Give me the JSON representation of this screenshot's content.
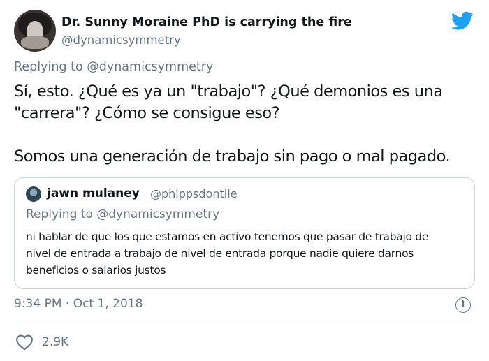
{
  "author": {
    "name": "Dr. Sunny Moraine PhD is carrying the fire",
    "handle": "@dynamicsymmetry"
  },
  "replying": {
    "prefix": "Replying to",
    "handle": "@dynamicsymmetry"
  },
  "tweet": {
    "lines": [
      "Sí, esto. ¿Qué es ya un \"trabajo\"? ¿Qué demonios es una",
      "\"carrera\"? ¿Cómo se consigue eso?",
      "Somos una generación de trabajo sin pago o mal pagado."
    ]
  },
  "quoted": {
    "name": "jawn mulaney",
    "handle": "@phippsdontlie",
    "replying_prefix": "Replying to",
    "replying_handle": "@dynamicsymmetry",
    "lines": [
      "ni hablar de que los que estamos en activo tenemos que pasar de trabajo de",
      "nivel de entrada a trabajo de nivel de entrada porque nadie quiere darnos",
      "beneficios o salarios justos"
    ]
  },
  "meta": {
    "timestamp": "9:34 PM · Oct 1, 2018",
    "info_glyph": "i"
  },
  "actions": {
    "likes": "2.9K"
  },
  "icons": {
    "brand": "twitter-bird-icon",
    "like": "heart-icon",
    "info": "info-icon"
  },
  "colors": {
    "brand": "#1da1f2",
    "secondary_text": "#657786",
    "border": "#ccd6dd"
  }
}
